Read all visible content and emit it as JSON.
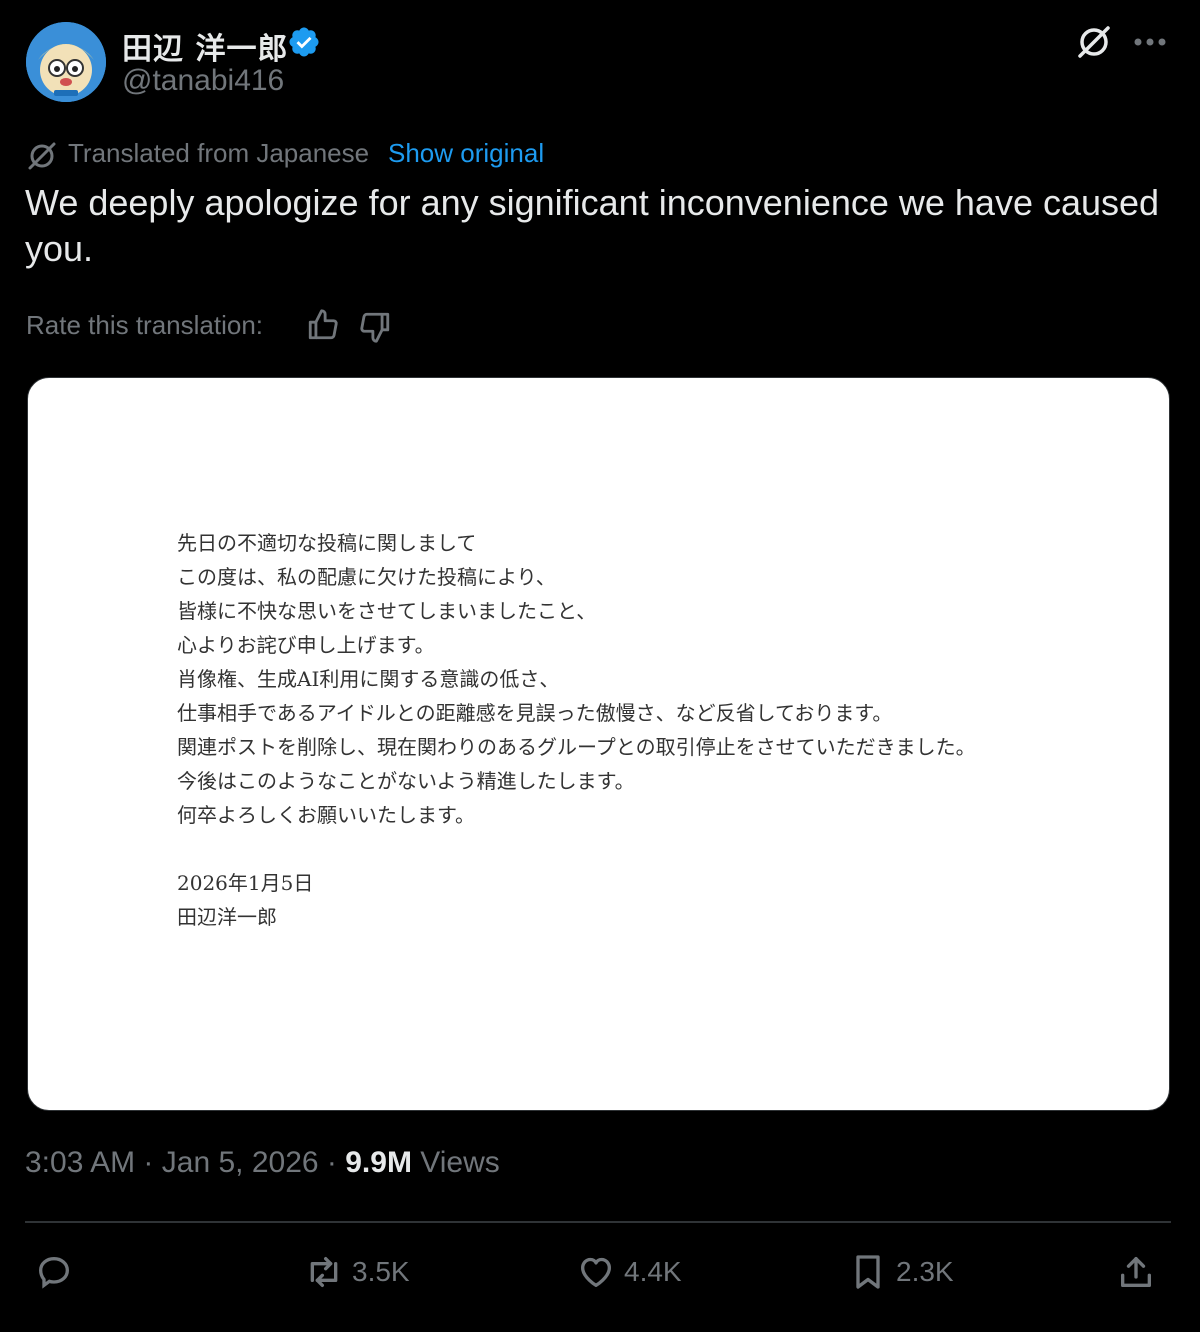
{
  "author": {
    "display_name": "田辺 洋一郎",
    "handle": "@tanabi416",
    "verified": true,
    "verified_color": "#1d9bf0",
    "avatar_icon": "cartoon-avatar"
  },
  "translation": {
    "label": "Translated from Japanese",
    "show_original": "Show original",
    "accent_color": "#1d9bf0"
  },
  "tweet_text": "We deeply apologize for any significant inconvenience we have caused you.",
  "rate": {
    "label": "Rate this translation:"
  },
  "media": {
    "lines": [
      "先日の不適切な投稿に関しまして",
      "この度は、私の配慮に欠けた投稿により、",
      "皆様に不快な思いをさせてしまいましたこと、",
      "心よりお詫び申し上げます。",
      "肖像権、生成AI利用に関する意識の低さ、",
      "仕事相手であるアイドルとの距離感を見誤った傲慢さ、など反省しております。",
      "関連ポストを削除し、現在関わりのあるグループとの取引停止をさせていただきました。",
      "今後はこのようなことがないよう精進したします。",
      "何卒よろしくお願いいたします。"
    ],
    "date": "2026年1月5日",
    "signature": "田辺洋一郎"
  },
  "meta": {
    "time": "3:03 AM",
    "date": "Jan 5, 2026",
    "separator": "·",
    "views_count": "9.9M",
    "views_label": "Views"
  },
  "actions": {
    "reply_icon": "reply-icon",
    "retweet_count": "3.5K",
    "like_count": "4.4K",
    "bookmark_count": "2.3K",
    "share_icon": "share-icon"
  }
}
